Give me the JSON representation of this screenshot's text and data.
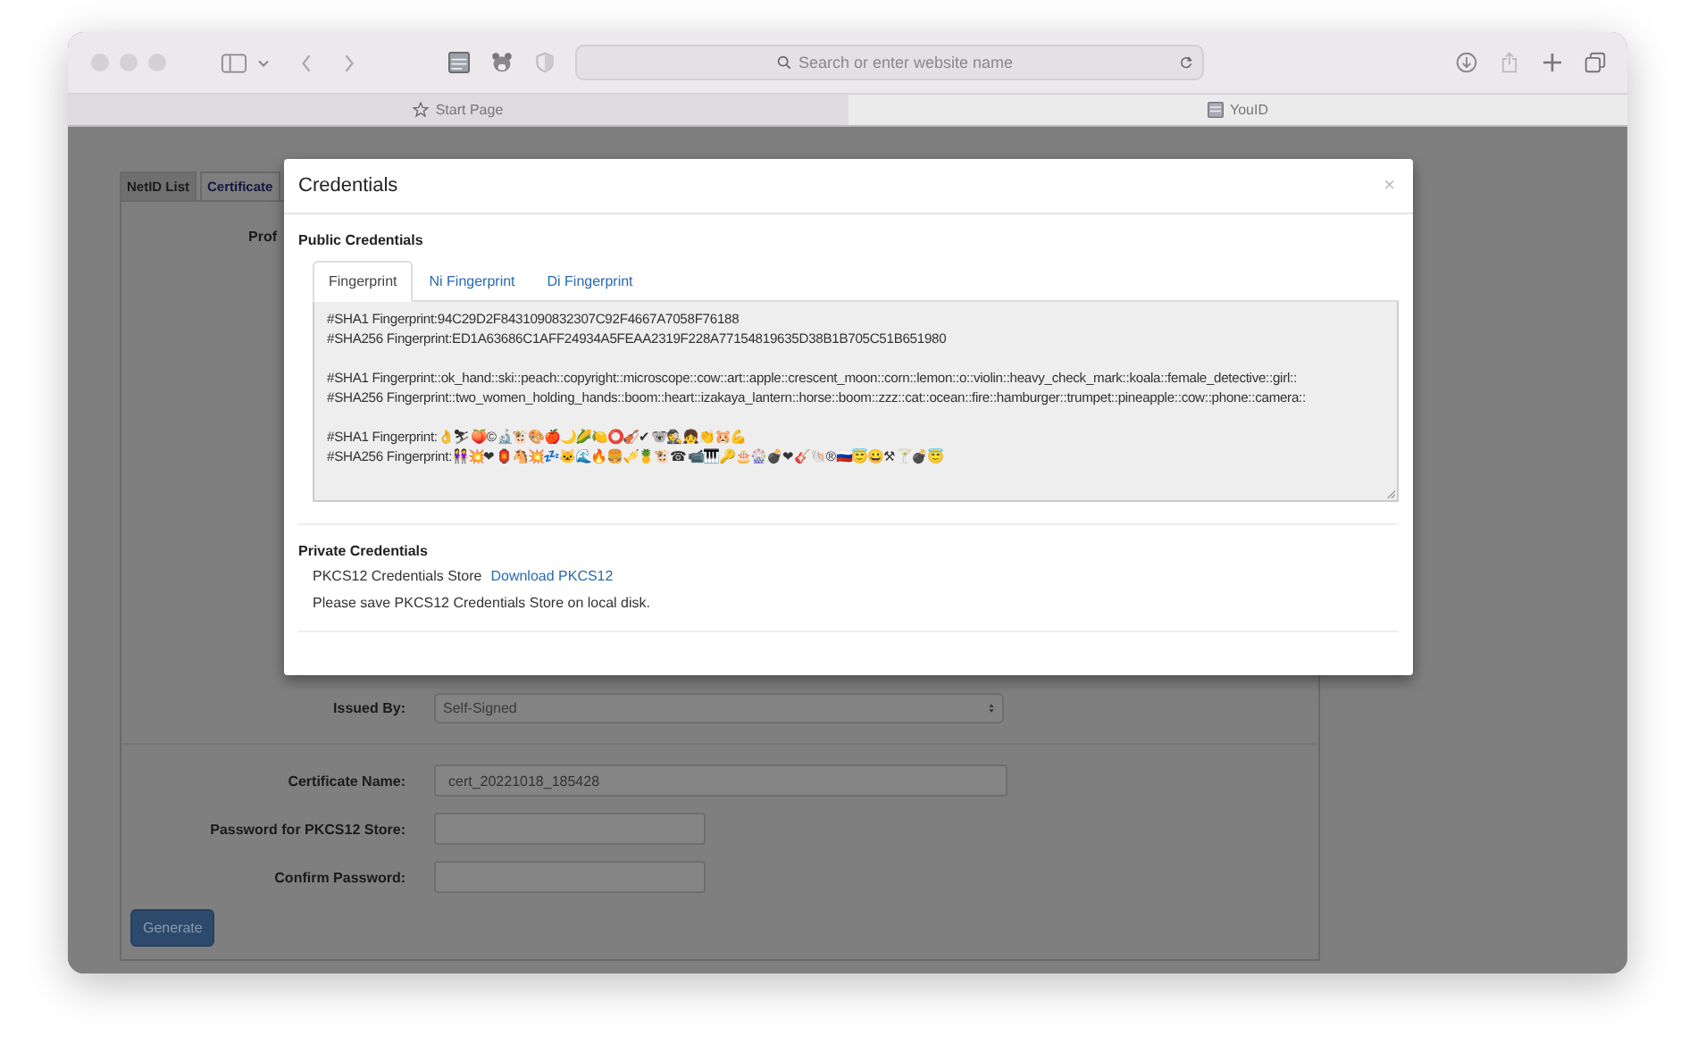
{
  "browser": {
    "address_bar": {
      "placeholder": "Search or enter website name"
    },
    "tabs": [
      {
        "label": "Start Page",
        "selected": false
      },
      {
        "label": "YouID",
        "selected": true
      }
    ]
  },
  "page": {
    "tabs": [
      {
        "label": "NetID List",
        "selected": false
      },
      {
        "label": "Certificate",
        "selected": true
      }
    ],
    "profile_label": "Prof",
    "issued_by": {
      "label": "Issued By:",
      "value": "Self-Signed"
    },
    "certificate_name": {
      "label": "Certificate Name:",
      "value": "cert_20221018_185428"
    },
    "password": {
      "label": "Password for PKCS12 Store:"
    },
    "confirm_password": {
      "label": "Confirm Password:"
    },
    "generate_button": "Generate"
  },
  "modal": {
    "title": "Credentials",
    "close": "×",
    "public_credentials": {
      "heading": "Public Credentials",
      "tabs": [
        {
          "label": "Fingerprint",
          "selected": true
        },
        {
          "label": "Ni Fingerprint",
          "selected": false
        },
        {
          "label": "Di Fingerprint",
          "selected": false
        }
      ],
      "fingerprint_groups": [
        [
          "#SHA1 Fingerprint:94C29D2F8431090832307C92F4667A7058F76188",
          "#SHA256 Fingerprint:ED1A63686C1AFF24934A5FEAA2319F228A77154819635D38B1B705C51B651980"
        ],
        [
          "#SHA1 Fingerprint::ok_hand::ski::peach::copyright::microscope::cow::art::apple::crescent_moon::corn::lemon::o::violin::heavy_check_mark::koala::female_detective::girl::",
          "#SHA256 Fingerprint::two_women_holding_hands::boom::heart::izakaya_lantern::horse::boom::zzz::cat::ocean::fire::hamburger::trumpet::pineapple::cow::phone::camera::"
        ],
        [
          "#SHA1 Fingerprint:👌⛷🍑©🔬🐮🎨🍎🌙🌽🍋⭕🎻✔🐨🕵👧👏🐹💪",
          "#SHA256 Fingerprint:👭💥❤🏮🐴💥💤🐱🌊🔥🍔🎺🍍🐮☎📹🎹🔑🎂🎡💣❤🎸🐚®🇷🇺😇😀⚒🍸💣😇"
        ]
      ]
    },
    "private_credentials": {
      "heading": "Private Credentials",
      "store_label": "PKCS12 Credentials Store",
      "download_link": "Download PKCS12",
      "note": "Please save PKCS12 Credentials Store on local disk."
    }
  }
}
